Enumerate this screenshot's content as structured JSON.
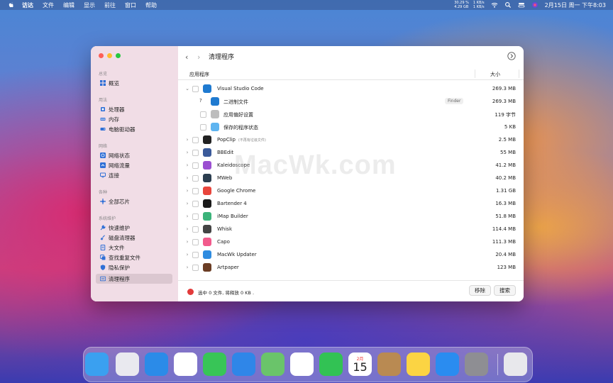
{
  "menubar": {
    "menus": [
      "访达",
      "文件",
      "编辑",
      "显示",
      "前往",
      "窗口",
      "帮助"
    ],
    "stats": {
      "cpu": "30.29 %",
      "mem": "4.29 GB",
      "net_up": "1 KB/s",
      "net_down": "1 KB/s"
    },
    "clock": "2月15日 周一 下午8:03"
  },
  "sidebar": {
    "sections": [
      {
        "header": "总览",
        "items": [
          {
            "label": "概览",
            "icon": "grid-icon",
            "color": "#2f6fd6"
          }
        ]
      },
      {
        "header": "用法",
        "items": [
          {
            "label": "处理器",
            "icon": "cpu-icon",
            "color": "#2f6fd6"
          },
          {
            "label": "内存",
            "icon": "memory-icon",
            "color": "#2f6fd6"
          },
          {
            "label": "电脑驱动器",
            "icon": "drive-icon",
            "color": "#2f6fd6"
          }
        ]
      },
      {
        "header": "网络",
        "items": [
          {
            "label": "网络状态",
            "icon": "network-icon",
            "color": "#2f6fd6"
          },
          {
            "label": "网络流量",
            "icon": "traffic-icon",
            "color": "#2f6fd6"
          },
          {
            "label": "连接",
            "icon": "monitor-icon",
            "color": "#2f6fd6"
          }
        ]
      },
      {
        "header": "各种",
        "items": [
          {
            "label": "全部芯片",
            "icon": "chip-icon",
            "color": "#2f6fd6"
          }
        ]
      },
      {
        "header": "系统维护",
        "items": [
          {
            "label": "快速维护",
            "icon": "wrench-icon",
            "color": "#2f6fd6"
          },
          {
            "label": "磁盘清理器",
            "icon": "broom-icon",
            "color": "#2f6fd6"
          },
          {
            "label": "大文件",
            "icon": "file-icon",
            "color": "#2f6fd6"
          },
          {
            "label": "查找重复文件",
            "icon": "duplicate-icon",
            "color": "#2f6fd6"
          },
          {
            "label": "隐私保护",
            "icon": "shield-icon",
            "color": "#2f6fd6"
          },
          {
            "label": "清理程序",
            "icon": "uninstall-icon",
            "color": "#2f6fd6",
            "active": true
          }
        ]
      }
    ]
  },
  "main": {
    "title": "清理程序",
    "columns": {
      "app": "应用程序",
      "size": "大小"
    },
    "rows": [
      {
        "name": "Visual Studio Code",
        "size": "269.3 MB",
        "expanded": true,
        "level": 0,
        "icon": "vscode-icon",
        "color": "#1f7ad0"
      },
      {
        "name": "二进制文件",
        "size": "269.3 MB",
        "level": 1,
        "prefix": "?",
        "tag": "Finder",
        "icon": "vscode-icon",
        "color": "#1f7ad0"
      },
      {
        "name": "应用偏好设置",
        "size": "119 字节",
        "level": 1,
        "icon": "prefs-file-icon",
        "color": "#bdbdbd"
      },
      {
        "name": "保存的程序状态",
        "size": "5 KB",
        "level": 1,
        "icon": "folder-icon",
        "color": "#5eb4f0"
      },
      {
        "name": "PopClip",
        "note": "(不再有垃圾文件)",
        "size": "2.5 MB",
        "level": 0,
        "icon": "popclip-icon",
        "color": "#222222"
      },
      {
        "name": "BBEdit",
        "size": "55 MB",
        "level": 0,
        "icon": "bbedit-icon",
        "color": "#3a5a9a"
      },
      {
        "name": "Kaleidoscope",
        "size": "41.2 MB",
        "level": 0,
        "icon": "kaleidoscope-icon",
        "color": "#9b4fd1"
      },
      {
        "name": "MWeb",
        "size": "40.2 MB",
        "level": 0,
        "icon": "mweb-icon",
        "color": "#2c3e50"
      },
      {
        "name": "Google Chrome",
        "size": "1.31 GB",
        "level": 0,
        "icon": "chrome-icon",
        "color": "#e8453c"
      },
      {
        "name": "Bartender 4",
        "size": "16.3 MB",
        "level": 0,
        "icon": "bartender-icon",
        "color": "#1a1a1a"
      },
      {
        "name": "iMap Builder",
        "size": "51.8 MB",
        "level": 0,
        "icon": "imap-icon",
        "color": "#3bb37a"
      },
      {
        "name": "Whisk",
        "size": "114.4 MB",
        "level": 0,
        "icon": "whisk-icon",
        "color": "#444444"
      },
      {
        "name": "Capo",
        "size": "111.3 MB",
        "level": 0,
        "icon": "capo-icon",
        "color": "#f25a8c"
      },
      {
        "name": "MacWk Updater",
        "size": "20.4 MB",
        "level": 0,
        "icon": "updater-icon",
        "color": "#2f8ce0"
      },
      {
        "name": "Artpaper",
        "size": "123 MB",
        "level": 0,
        "icon": "artpaper-icon",
        "color": "#6b3d24"
      }
    ],
    "footer": {
      "status": "选中 0 文件, 将释放 0 KB .",
      "remove_label": "移除",
      "search_label": "搜索"
    }
  },
  "watermark": "MacWk.com",
  "dock": {
    "calendar_month": "2月",
    "calendar_day": "15",
    "apps": [
      {
        "name": "finder-icon",
        "color": "#3aa0f0"
      },
      {
        "name": "launchpad-icon",
        "color": "#e9e9ef"
      },
      {
        "name": "safari-icon",
        "color": "#2b8be8"
      },
      {
        "name": "chrome-icon",
        "color": "#ffffff"
      },
      {
        "name": "messages-icon",
        "color": "#38c557"
      },
      {
        "name": "mail-icon",
        "color": "#2f86e8"
      },
      {
        "name": "maps-icon",
        "color": "#6ac46a"
      },
      {
        "name": "photos-icon",
        "color": "#ffffff"
      },
      {
        "name": "facetime-icon",
        "color": "#32c254"
      },
      {
        "name": "calendar-icon",
        "color": "#ffffff"
      },
      {
        "name": "contacts-icon",
        "color": "#b98a52"
      },
      {
        "name": "notes-icon",
        "color": "#fbd443"
      },
      {
        "name": "appstore-icon",
        "color": "#2a8cf0"
      },
      {
        "name": "settings-icon",
        "color": "#8e8e93"
      },
      {
        "name": "trash-icon",
        "color": "#e8e8ec"
      }
    ]
  }
}
